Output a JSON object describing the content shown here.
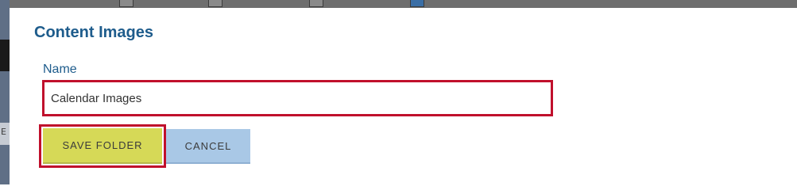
{
  "background": {
    "left_partial_letter": "E"
  },
  "modal": {
    "title": "Content Images",
    "name_label": "Name",
    "name_value": "Calendar Images",
    "save_label": "SAVE FOLDER",
    "cancel_label": "CANCEL"
  },
  "colors": {
    "title": "#1e5c8c",
    "highlight_border": "#c0102c",
    "save_bg": "#d6d957",
    "cancel_bg": "#a9c8e6"
  }
}
